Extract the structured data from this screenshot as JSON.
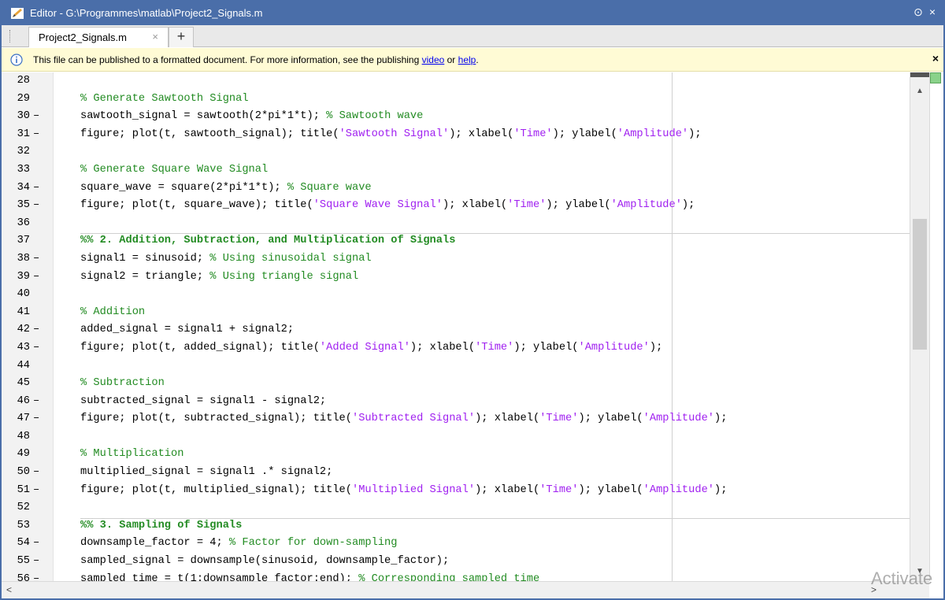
{
  "window": {
    "title": "Editor - G:\\Programmes\\matlab\\Project2_Signals.m",
    "controls": [
      "⊙",
      "×"
    ]
  },
  "tabs": [
    {
      "label": "Project2_Signals.m",
      "close": "×"
    }
  ],
  "add_tab": "+",
  "notice": {
    "text_before": "This file can be published to a formatted document. For more information, see the publishing ",
    "link1": "video",
    "text_mid": " or ",
    "link2": "help",
    "text_after": ".",
    "close": "×"
  },
  "watermark": "Activate",
  "colors": {
    "titlebar": "#4a6ea9",
    "comment": "#228b22",
    "string": "#a020f0",
    "notice_bg": "#fffbd5"
  },
  "scroll": {
    "up": "▲",
    "down": "▼",
    "left": "<",
    "right": ">"
  },
  "code_lines": [
    {
      "num": "28",
      "dash": "",
      "tokens": []
    },
    {
      "num": "29",
      "dash": "",
      "tokens": [
        {
          "t": "% Generate Sawtooth Signal",
          "c": "cm"
        }
      ]
    },
    {
      "num": "30",
      "dash": "–",
      "tokens": [
        {
          "t": "sawtooth_signal = sawtooth(2*pi*1*t); ",
          "c": ""
        },
        {
          "t": "% Sawtooth wave",
          "c": "cm"
        }
      ]
    },
    {
      "num": "31",
      "dash": "–",
      "tokens": [
        {
          "t": "figure; plot(t, sawtooth_signal); title(",
          "c": ""
        },
        {
          "t": "'Sawtooth Signal'",
          "c": "str"
        },
        {
          "t": "); xlabel(",
          "c": ""
        },
        {
          "t": "'Time'",
          "c": "str"
        },
        {
          "t": "); ylabel(",
          "c": ""
        },
        {
          "t": "'Amplitude'",
          "c": "str"
        },
        {
          "t": ");",
          "c": ""
        }
      ]
    },
    {
      "num": "32",
      "dash": "",
      "tokens": []
    },
    {
      "num": "33",
      "dash": "",
      "tokens": [
        {
          "t": "% Generate Square Wave Signal",
          "c": "cm"
        }
      ]
    },
    {
      "num": "34",
      "dash": "–",
      "tokens": [
        {
          "t": "square_wave = square(2*pi*1*t); ",
          "c": ""
        },
        {
          "t": "% Square wave",
          "c": "cm"
        }
      ]
    },
    {
      "num": "35",
      "dash": "–",
      "tokens": [
        {
          "t": "figure; plot(t, square_wave); title(",
          "c": ""
        },
        {
          "t": "'Square Wave Signal'",
          "c": "str"
        },
        {
          "t": "); xlabel(",
          "c": ""
        },
        {
          "t": "'Time'",
          "c": "str"
        },
        {
          "t": "); ylabel(",
          "c": ""
        },
        {
          "t": "'Amplitude'",
          "c": "str"
        },
        {
          "t": ");",
          "c": ""
        }
      ]
    },
    {
      "num": "36",
      "dash": "",
      "tokens": []
    },
    {
      "num": "37",
      "dash": "",
      "cell": true,
      "tokens": [
        {
          "t": "%% 2. Addition, Subtraction, and Multiplication of Signals",
          "c": "cell"
        }
      ]
    },
    {
      "num": "38",
      "dash": "–",
      "tokens": [
        {
          "t": "signal1 = sinusoid; ",
          "c": ""
        },
        {
          "t": "% Using sinusoidal signal",
          "c": "cm"
        }
      ]
    },
    {
      "num": "39",
      "dash": "–",
      "tokens": [
        {
          "t": "signal2 = triangle; ",
          "c": ""
        },
        {
          "t": "% Using triangle signal",
          "c": "cm"
        }
      ]
    },
    {
      "num": "40",
      "dash": "",
      "tokens": []
    },
    {
      "num": "41",
      "dash": "",
      "tokens": [
        {
          "t": "% Addition",
          "c": "cm"
        }
      ]
    },
    {
      "num": "42",
      "dash": "–",
      "tokens": [
        {
          "t": "added_signal = signal1 + signal2;",
          "c": ""
        }
      ]
    },
    {
      "num": "43",
      "dash": "–",
      "tokens": [
        {
          "t": "figure; plot(t, added_signal); title(",
          "c": ""
        },
        {
          "t": "'Added Signal'",
          "c": "str"
        },
        {
          "t": "); xlabel(",
          "c": ""
        },
        {
          "t": "'Time'",
          "c": "str"
        },
        {
          "t": "); ylabel(",
          "c": ""
        },
        {
          "t": "'Amplitude'",
          "c": "str"
        },
        {
          "t": ");",
          "c": ""
        }
      ]
    },
    {
      "num": "44",
      "dash": "",
      "tokens": []
    },
    {
      "num": "45",
      "dash": "",
      "tokens": [
        {
          "t": "% Subtraction",
          "c": "cm"
        }
      ]
    },
    {
      "num": "46",
      "dash": "–",
      "tokens": [
        {
          "t": "subtracted_signal = signal1 - signal2;",
          "c": ""
        }
      ]
    },
    {
      "num": "47",
      "dash": "–",
      "tokens": [
        {
          "t": "figure; plot(t, subtracted_signal); title(",
          "c": ""
        },
        {
          "t": "'Subtracted Signal'",
          "c": "str"
        },
        {
          "t": "); xlabel(",
          "c": ""
        },
        {
          "t": "'Time'",
          "c": "str"
        },
        {
          "t": "); ylabel(",
          "c": ""
        },
        {
          "t": "'Amplitude'",
          "c": "str"
        },
        {
          "t": ");",
          "c": ""
        }
      ]
    },
    {
      "num": "48",
      "dash": "",
      "tokens": []
    },
    {
      "num": "49",
      "dash": "",
      "tokens": [
        {
          "t": "% Multiplication",
          "c": "cm"
        }
      ]
    },
    {
      "num": "50",
      "dash": "–",
      "tokens": [
        {
          "t": "multiplied_signal = signal1 .* signal2;",
          "c": ""
        }
      ]
    },
    {
      "num": "51",
      "dash": "–",
      "tokens": [
        {
          "t": "figure; plot(t, multiplied_signal); title(",
          "c": ""
        },
        {
          "t": "'Multiplied Signal'",
          "c": "str"
        },
        {
          "t": "); xlabel(",
          "c": ""
        },
        {
          "t": "'Time'",
          "c": "str"
        },
        {
          "t": "); ylabel(",
          "c": ""
        },
        {
          "t": "'Amplitude'",
          "c": "str"
        },
        {
          "t": ");",
          "c": ""
        }
      ]
    },
    {
      "num": "52",
      "dash": "",
      "tokens": []
    },
    {
      "num": "53",
      "dash": "",
      "cell": true,
      "tokens": [
        {
          "t": "%% 3. Sampling of Signals",
          "c": "cell"
        }
      ]
    },
    {
      "num": "54",
      "dash": "–",
      "tokens": [
        {
          "t": "downsample_factor = 4; ",
          "c": ""
        },
        {
          "t": "% Factor for down-sampling",
          "c": "cm"
        }
      ]
    },
    {
      "num": "55",
      "dash": "–",
      "tokens": [
        {
          "t": "sampled_signal = downsample(sinusoid, downsample_factor);",
          "c": ""
        }
      ]
    },
    {
      "num": "56",
      "dash": "–",
      "tokens": [
        {
          "t": "sampled_time = t(1:downsample_factor:end); ",
          "c": ""
        },
        {
          "t": "% Corresponding sampled time",
          "c": "cm"
        }
      ]
    }
  ]
}
